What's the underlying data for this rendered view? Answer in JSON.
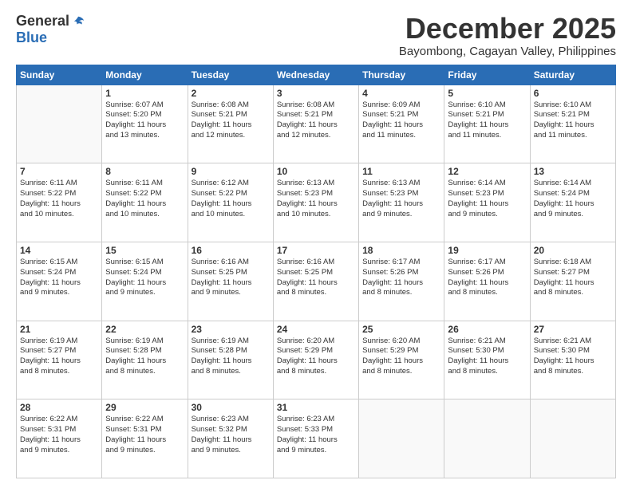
{
  "logo": {
    "general": "General",
    "blue": "Blue"
  },
  "title": {
    "month_year": "December 2025",
    "location": "Bayombong, Cagayan Valley, Philippines"
  },
  "weekdays": [
    "Sunday",
    "Monday",
    "Tuesday",
    "Wednesday",
    "Thursday",
    "Friday",
    "Saturday"
  ],
  "weeks": [
    [
      {
        "day": "",
        "info": ""
      },
      {
        "day": "1",
        "info": "Sunrise: 6:07 AM\nSunset: 5:20 PM\nDaylight: 11 hours\nand 13 minutes."
      },
      {
        "day": "2",
        "info": "Sunrise: 6:08 AM\nSunset: 5:21 PM\nDaylight: 11 hours\nand 12 minutes."
      },
      {
        "day": "3",
        "info": "Sunrise: 6:08 AM\nSunset: 5:21 PM\nDaylight: 11 hours\nand 12 minutes."
      },
      {
        "day": "4",
        "info": "Sunrise: 6:09 AM\nSunset: 5:21 PM\nDaylight: 11 hours\nand 11 minutes."
      },
      {
        "day": "5",
        "info": "Sunrise: 6:10 AM\nSunset: 5:21 PM\nDaylight: 11 hours\nand 11 minutes."
      },
      {
        "day": "6",
        "info": "Sunrise: 6:10 AM\nSunset: 5:21 PM\nDaylight: 11 hours\nand 11 minutes."
      }
    ],
    [
      {
        "day": "7",
        "info": "Sunrise: 6:11 AM\nSunset: 5:22 PM\nDaylight: 11 hours\nand 10 minutes."
      },
      {
        "day": "8",
        "info": "Sunrise: 6:11 AM\nSunset: 5:22 PM\nDaylight: 11 hours\nand 10 minutes."
      },
      {
        "day": "9",
        "info": "Sunrise: 6:12 AM\nSunset: 5:22 PM\nDaylight: 11 hours\nand 10 minutes."
      },
      {
        "day": "10",
        "info": "Sunrise: 6:13 AM\nSunset: 5:23 PM\nDaylight: 11 hours\nand 10 minutes."
      },
      {
        "day": "11",
        "info": "Sunrise: 6:13 AM\nSunset: 5:23 PM\nDaylight: 11 hours\nand 9 minutes."
      },
      {
        "day": "12",
        "info": "Sunrise: 6:14 AM\nSunset: 5:23 PM\nDaylight: 11 hours\nand 9 minutes."
      },
      {
        "day": "13",
        "info": "Sunrise: 6:14 AM\nSunset: 5:24 PM\nDaylight: 11 hours\nand 9 minutes."
      }
    ],
    [
      {
        "day": "14",
        "info": "Sunrise: 6:15 AM\nSunset: 5:24 PM\nDaylight: 11 hours\nand 9 minutes."
      },
      {
        "day": "15",
        "info": "Sunrise: 6:15 AM\nSunset: 5:24 PM\nDaylight: 11 hours\nand 9 minutes."
      },
      {
        "day": "16",
        "info": "Sunrise: 6:16 AM\nSunset: 5:25 PM\nDaylight: 11 hours\nand 9 minutes."
      },
      {
        "day": "17",
        "info": "Sunrise: 6:16 AM\nSunset: 5:25 PM\nDaylight: 11 hours\nand 8 minutes."
      },
      {
        "day": "18",
        "info": "Sunrise: 6:17 AM\nSunset: 5:26 PM\nDaylight: 11 hours\nand 8 minutes."
      },
      {
        "day": "19",
        "info": "Sunrise: 6:17 AM\nSunset: 5:26 PM\nDaylight: 11 hours\nand 8 minutes."
      },
      {
        "day": "20",
        "info": "Sunrise: 6:18 AM\nSunset: 5:27 PM\nDaylight: 11 hours\nand 8 minutes."
      }
    ],
    [
      {
        "day": "21",
        "info": "Sunrise: 6:19 AM\nSunset: 5:27 PM\nDaylight: 11 hours\nand 8 minutes."
      },
      {
        "day": "22",
        "info": "Sunrise: 6:19 AM\nSunset: 5:28 PM\nDaylight: 11 hours\nand 8 minutes."
      },
      {
        "day": "23",
        "info": "Sunrise: 6:19 AM\nSunset: 5:28 PM\nDaylight: 11 hours\nand 8 minutes."
      },
      {
        "day": "24",
        "info": "Sunrise: 6:20 AM\nSunset: 5:29 PM\nDaylight: 11 hours\nand 8 minutes."
      },
      {
        "day": "25",
        "info": "Sunrise: 6:20 AM\nSunset: 5:29 PM\nDaylight: 11 hours\nand 8 minutes."
      },
      {
        "day": "26",
        "info": "Sunrise: 6:21 AM\nSunset: 5:30 PM\nDaylight: 11 hours\nand 8 minutes."
      },
      {
        "day": "27",
        "info": "Sunrise: 6:21 AM\nSunset: 5:30 PM\nDaylight: 11 hours\nand 8 minutes."
      }
    ],
    [
      {
        "day": "28",
        "info": "Sunrise: 6:22 AM\nSunset: 5:31 PM\nDaylight: 11 hours\nand 9 minutes."
      },
      {
        "day": "29",
        "info": "Sunrise: 6:22 AM\nSunset: 5:31 PM\nDaylight: 11 hours\nand 9 minutes."
      },
      {
        "day": "30",
        "info": "Sunrise: 6:23 AM\nSunset: 5:32 PM\nDaylight: 11 hours\nand 9 minutes."
      },
      {
        "day": "31",
        "info": "Sunrise: 6:23 AM\nSunset: 5:33 PM\nDaylight: 11 hours\nand 9 minutes."
      },
      {
        "day": "",
        "info": ""
      },
      {
        "day": "",
        "info": ""
      },
      {
        "day": "",
        "info": ""
      }
    ]
  ]
}
